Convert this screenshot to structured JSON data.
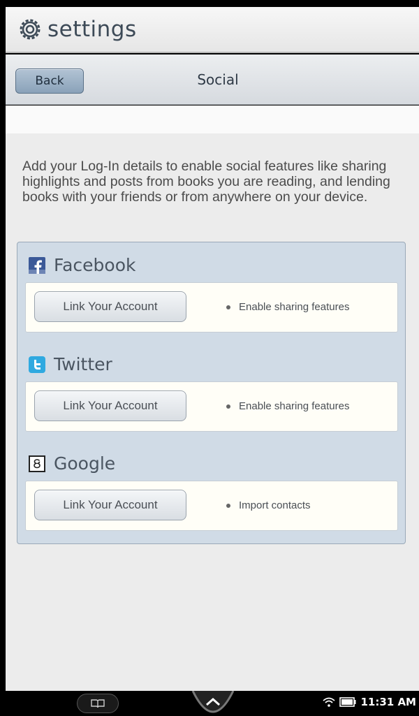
{
  "header": {
    "app_title": "settings",
    "icon": "gear-icon"
  },
  "nav": {
    "back_label": "Back",
    "title": "Social"
  },
  "intro_text": "Add your Log-In details to enable social features like sharing highlights and posts from books you are reading, and lending books with your friends or from anywhere on your device.",
  "services": [
    {
      "name": "Facebook",
      "icon": "facebook-icon",
      "button_label": "Link Your Account",
      "feature": "Enable sharing features"
    },
    {
      "name": "Twitter",
      "icon": "twitter-icon",
      "button_label": "Link Your Account",
      "feature": "Enable sharing features"
    },
    {
      "name": "Google",
      "icon": "google-icon",
      "button_label": "Link Your Account",
      "feature": "Import contacts"
    }
  ],
  "system_bar": {
    "time": "11:31 AM",
    "icons": [
      "book-icon",
      "home-chevron-icon",
      "wifi-icon",
      "battery-icon"
    ]
  },
  "colors": {
    "panel_bg": "#d0dbe6",
    "card_bg": "#fffef7",
    "back_button": "#8aa2b9"
  }
}
